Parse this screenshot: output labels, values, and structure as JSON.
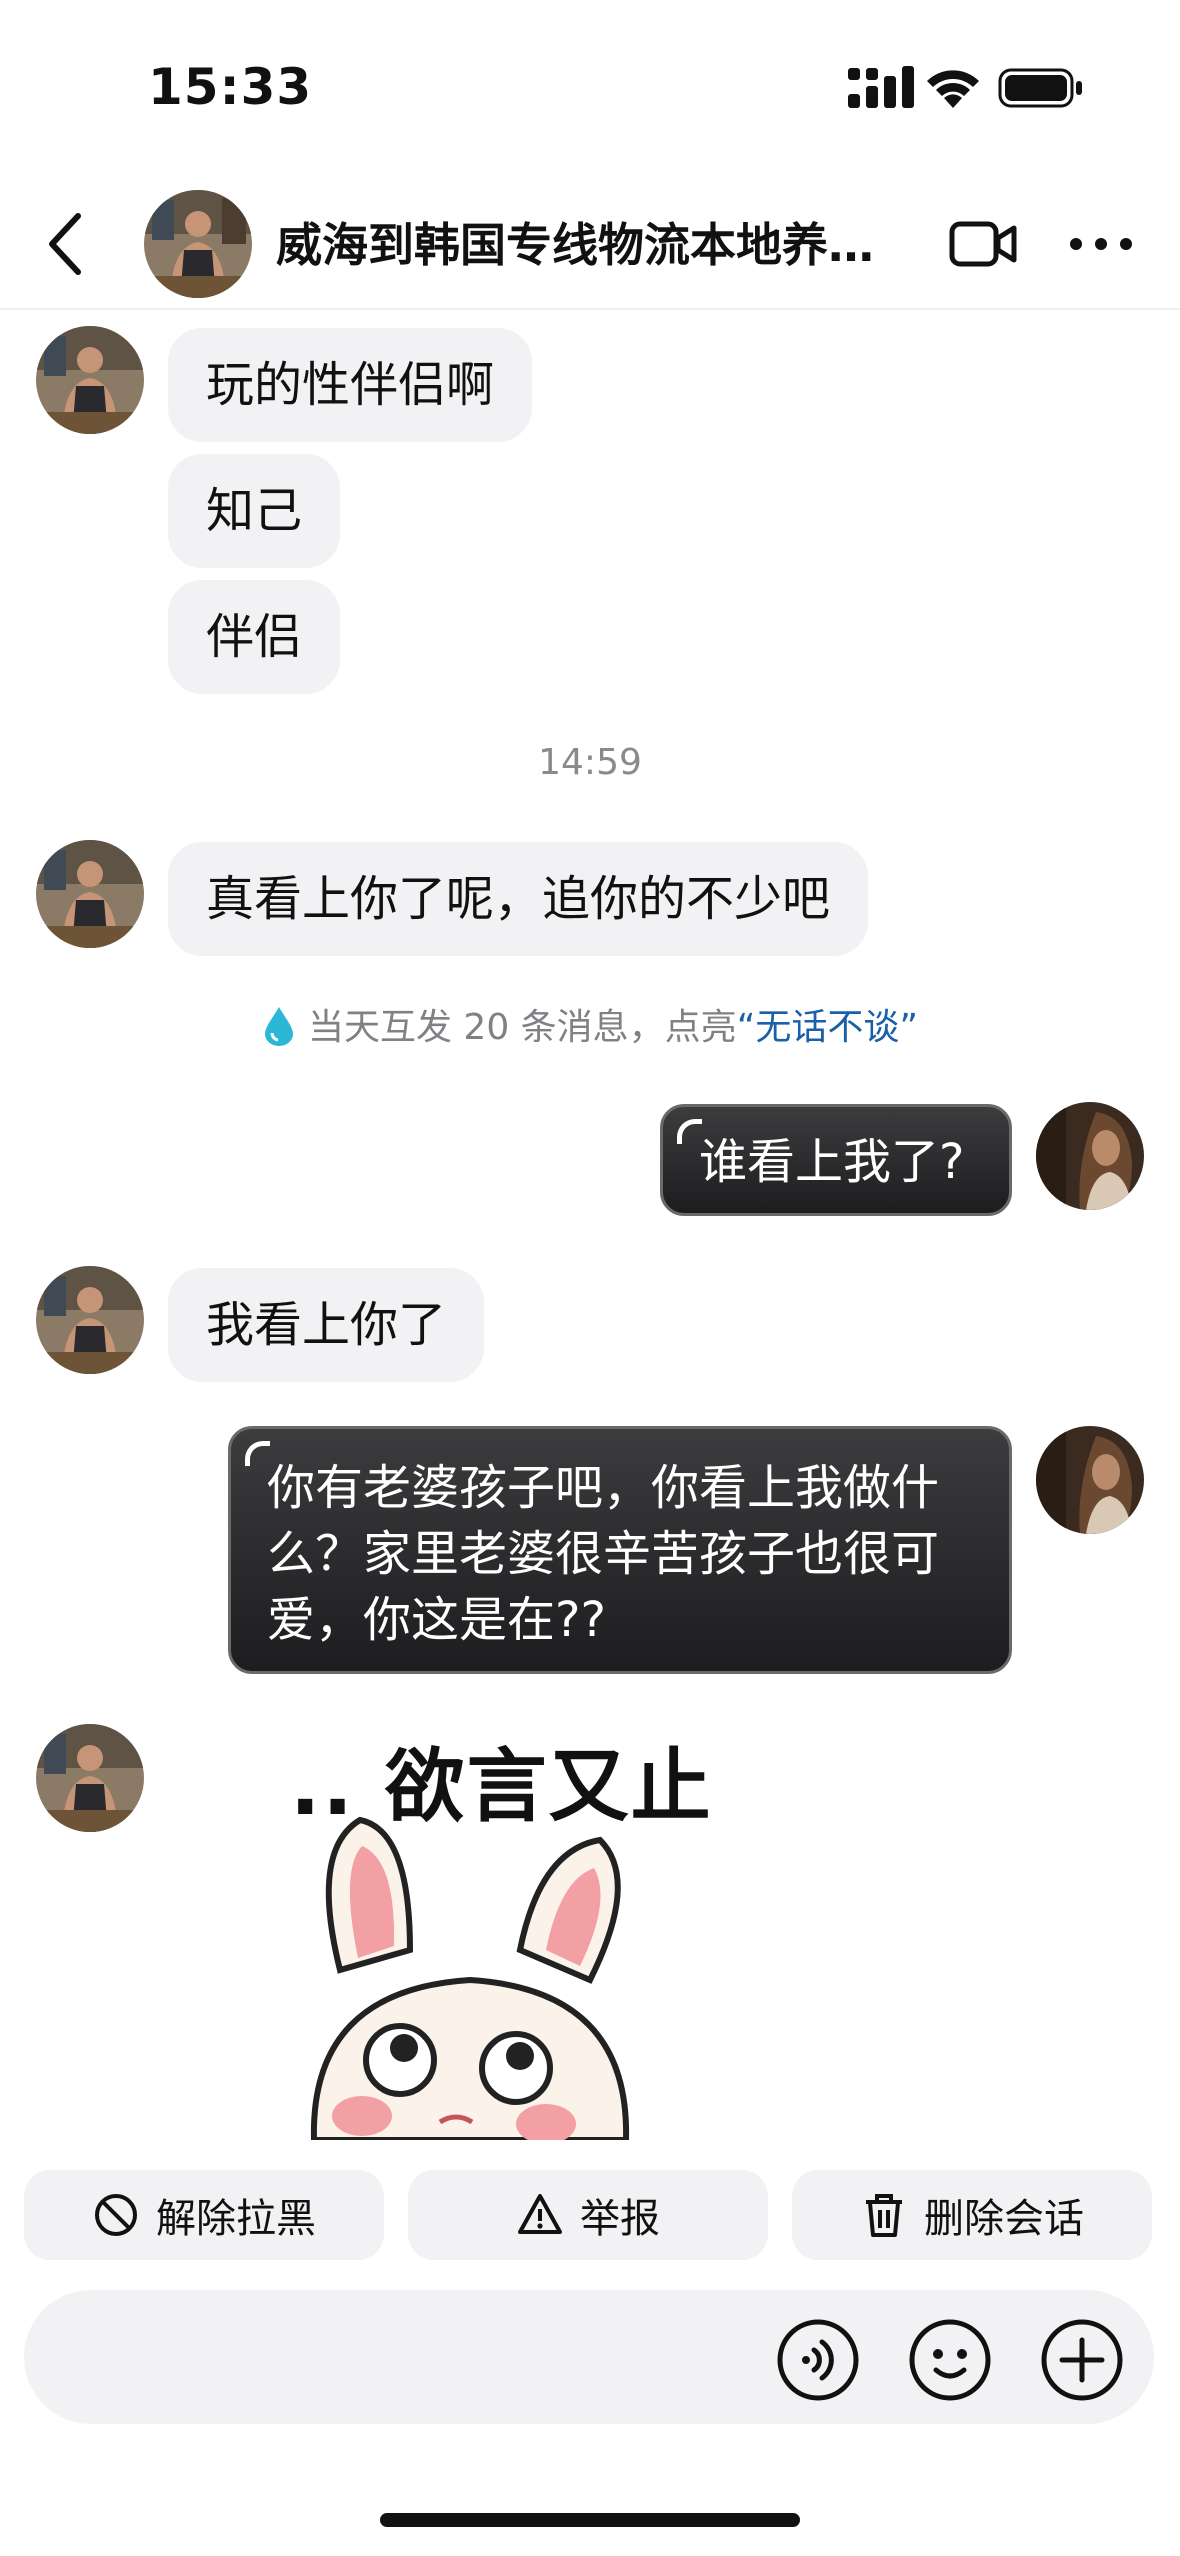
{
  "status_bar": {
    "time": "15:33"
  },
  "header": {
    "title": "威海到韩国专线物流本地养貂…",
    "icons": [
      "back-icon",
      "video-call-icon",
      "more-icon"
    ]
  },
  "messages": [
    {
      "side": "left",
      "text": "玩的性伴侣啊"
    },
    {
      "side": "left",
      "text": "知己"
    },
    {
      "side": "left",
      "text": "伴侣"
    },
    {
      "type": "timestamp",
      "text": "14:59"
    },
    {
      "side": "left",
      "text": "真看上你了呢，追你的不少吧"
    },
    {
      "type": "hint",
      "prefix": "当天互发 20 条消息，点亮",
      "highlight": "“无话不谈”"
    },
    {
      "side": "right",
      "text": "谁看上我了?"
    },
    {
      "side": "left",
      "text": "我看上你了"
    },
    {
      "side": "right",
      "lines": [
        "你有老婆孩子吧，你看上我做什",
        "么？家里老婆很辛苦孩子也很可",
        "爱，你这是在??"
      ]
    },
    {
      "side": "left",
      "type": "sticker",
      "caption": ".. 欲言又止"
    }
  ],
  "actions": {
    "unblock": "解除拉黑",
    "report": "举报",
    "delete": "删除会话"
  },
  "input_bar": {
    "icons": [
      "voice-icon",
      "emoji-icon",
      "plus-icon"
    ]
  },
  "colors": {
    "bubble_left": "#f2f2f4",
    "bubble_right": "#2a2a2c",
    "hint_highlight": "#1b5fa8",
    "hint_drop": "#2bb8d6"
  }
}
